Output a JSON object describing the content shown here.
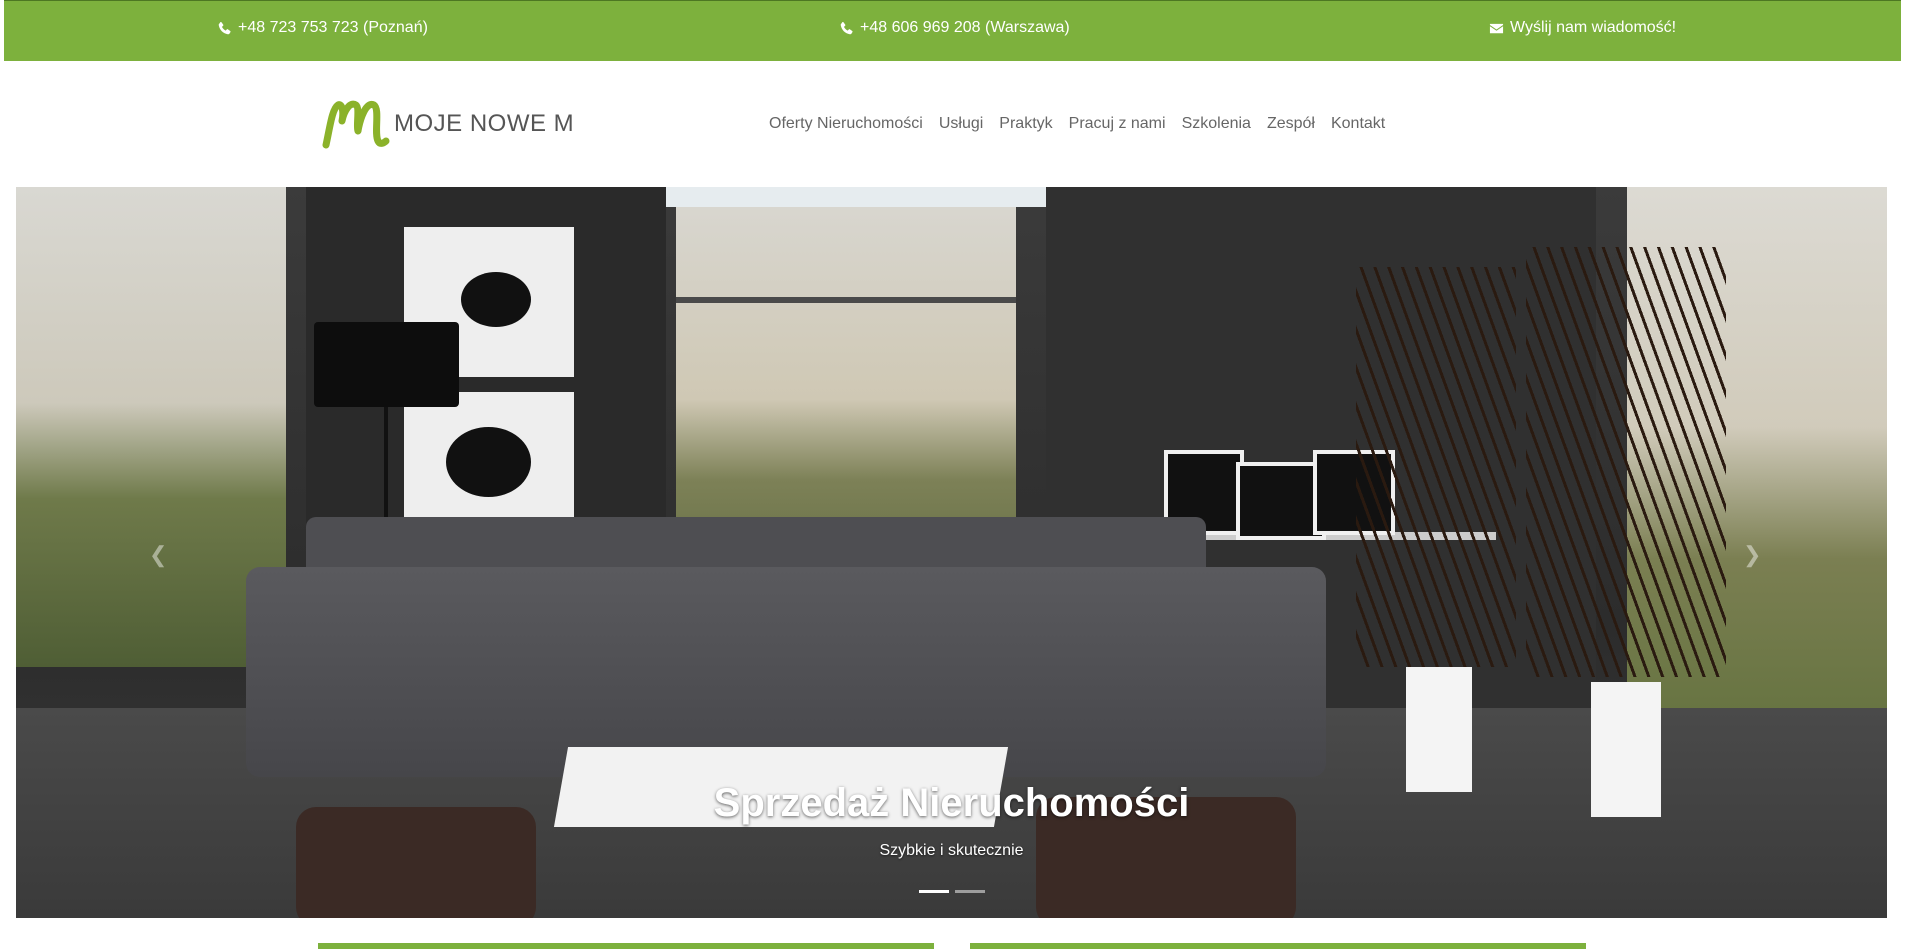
{
  "topbar": {
    "contacts": [
      {
        "icon": "phone-icon",
        "text": "+48 723 753 723 (Poznań)"
      },
      {
        "icon": "phone-icon",
        "text": "+48 606 969 208 (Warszawa)"
      },
      {
        "icon": "envelope-icon",
        "text": "Wyślij nam wiadomość!"
      }
    ],
    "color": "#7db13d"
  },
  "header": {
    "logo_text": "MOJE NOWE M",
    "nav": [
      {
        "label": "Oferty Nieruchomości"
      },
      {
        "label": "Usługi"
      },
      {
        "label": "Praktyk"
      },
      {
        "label": "Pracuj z nami"
      },
      {
        "label": "Szkolenia"
      },
      {
        "label": "Zespół"
      },
      {
        "label": "Kontakt"
      }
    ]
  },
  "hero": {
    "title": "Sprzedaż Nieruchomości",
    "subtitle": "Szybkie i skutecznie",
    "slides_total": 2,
    "active_slide": 1,
    "prev_icon": "chevron-left-icon",
    "next_icon": "chevron-right-icon"
  },
  "colors": {
    "accent": "#7db13d",
    "logo_green": "#8bb22a",
    "nav_text": "#666666"
  }
}
